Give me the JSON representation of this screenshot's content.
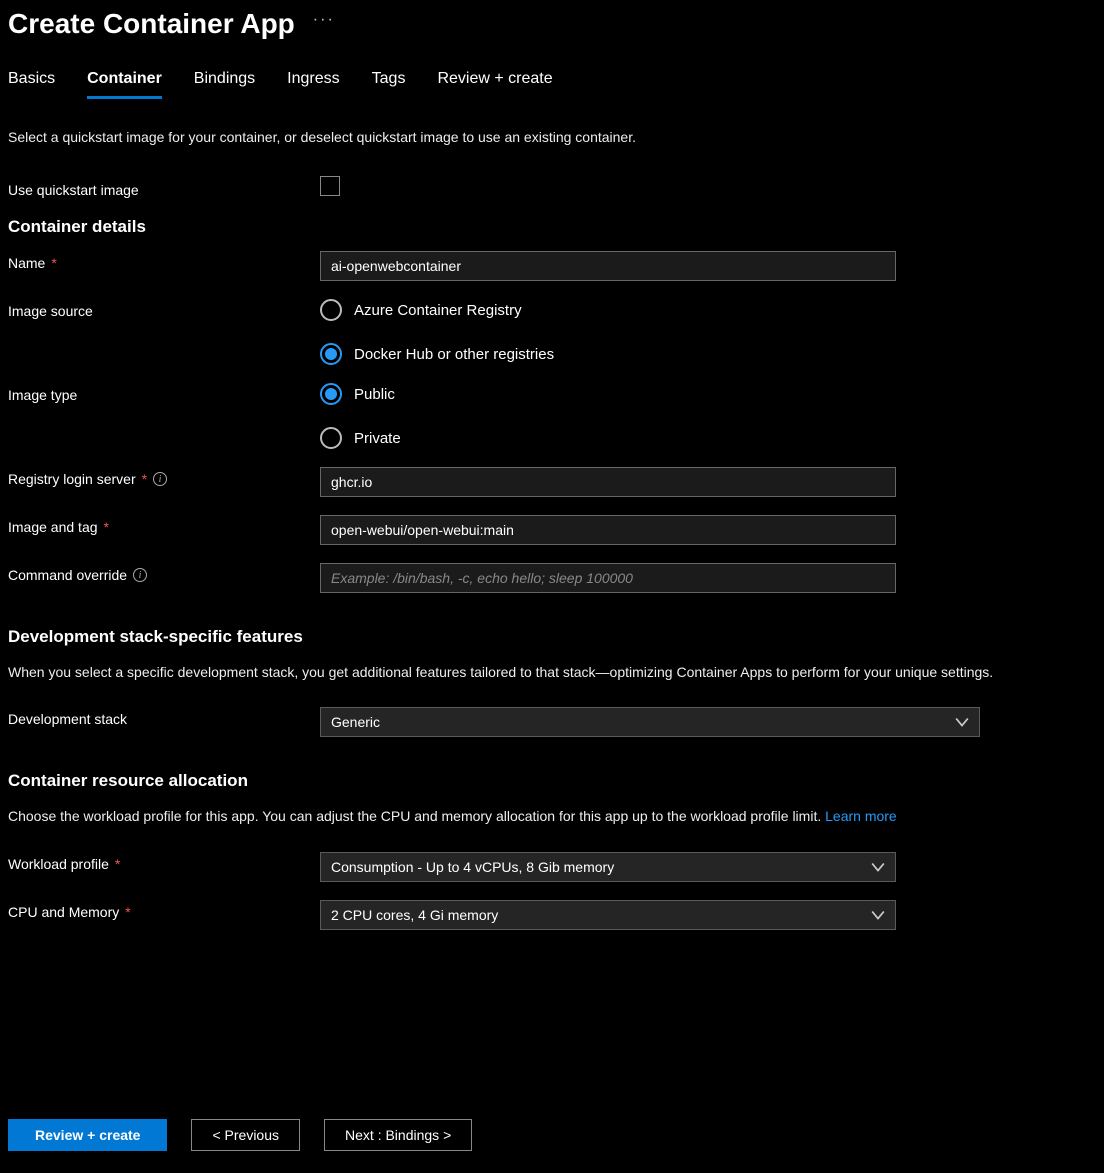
{
  "header": {
    "title": "Create Container App"
  },
  "tabs": {
    "items": [
      {
        "label": "Basics",
        "active": false
      },
      {
        "label": "Container",
        "active": true
      },
      {
        "label": "Bindings",
        "active": false
      },
      {
        "label": "Ingress",
        "active": false
      },
      {
        "label": "Tags",
        "active": false
      },
      {
        "label": "Review + create",
        "active": false
      }
    ]
  },
  "intro": "Select a quickstart image for your container, or deselect quickstart image to use an existing container.",
  "quickstart": {
    "label": "Use quickstart image"
  },
  "container_details": {
    "heading": "Container details",
    "name_label": "Name",
    "name_value": "ai-openwebcontainer",
    "image_source_label": "Image source",
    "image_source_options": {
      "acr": "Azure Container Registry",
      "docker": "Docker Hub or other registries"
    },
    "image_type_label": "Image type",
    "image_type_options": {
      "public": "Public",
      "private": "Private"
    },
    "registry_label": "Registry login server",
    "registry_value": "ghcr.io",
    "image_tag_label": "Image and tag",
    "image_tag_value": "open-webui/open-webui:main",
    "command_label": "Command override",
    "command_placeholder": "Example: /bin/bash, -c, echo hello; sleep 100000"
  },
  "dev_stack": {
    "heading": "Development stack-specific features",
    "desc": "When you select a specific development stack, you get additional features tailored to that stack—optimizing Container Apps to perform for your unique settings.",
    "label": "Development stack",
    "value": "Generic"
  },
  "resource": {
    "heading": "Container resource allocation",
    "desc_prefix": "Choose the workload profile for this app. You can adjust the CPU and memory allocation for this app up to the workload profile limit. ",
    "learn_more": "Learn more",
    "workload_label": "Workload profile",
    "workload_value": "Consumption - Up to 4 vCPUs, 8 Gib memory",
    "cpu_label": "CPU and Memory",
    "cpu_value": "2 CPU cores, 4 Gi memory"
  },
  "footer": {
    "review": "Review + create",
    "previous": "< Previous",
    "next": "Next : Bindings >"
  }
}
